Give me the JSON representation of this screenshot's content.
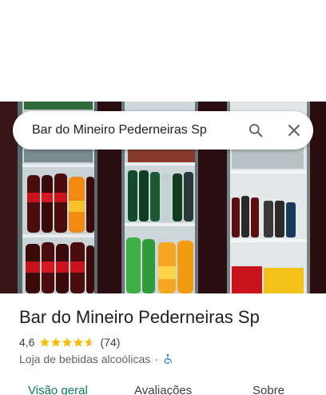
{
  "search": {
    "query": "Bar do Mineiro Pederneiras Sp",
    "search_icon": "search-icon",
    "close_icon": "close-icon"
  },
  "place": {
    "name": "Bar do Mineiro Pederneiras Sp",
    "rating": "4,6",
    "rating_value": 4.6,
    "review_count": "(74)",
    "category": "Loja de bebidas alcoólicas",
    "separator": "·",
    "accessibility_icon": "wheelchair-icon"
  },
  "tabs": {
    "overview": "Visão geral",
    "reviews": "Avaliações",
    "about": "Sobre"
  },
  "colors": {
    "accent": "#0b7b5f",
    "star": "#fbbc04",
    "accessibility": "#1a73e8"
  }
}
